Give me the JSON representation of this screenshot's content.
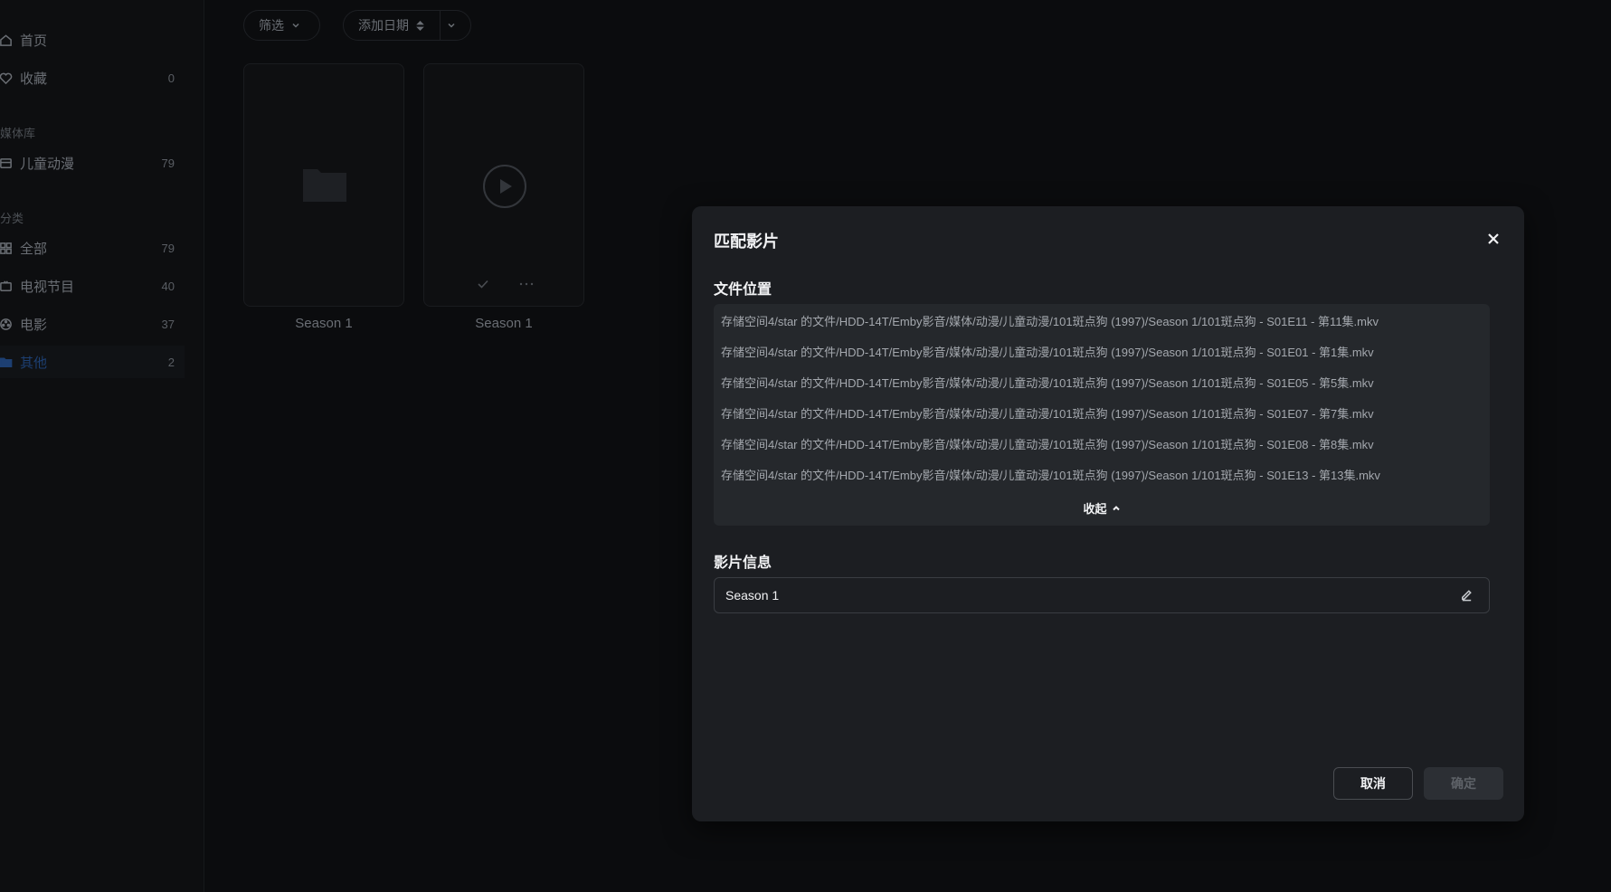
{
  "sidebar": {
    "nav": [
      {
        "label": "首页",
        "count": ""
      },
      {
        "label": "收藏",
        "count": "0"
      }
    ],
    "library_title": "媒体库",
    "libraries": [
      {
        "label": "儿童动漫",
        "count": "79"
      }
    ],
    "category_title": "分类",
    "categories": [
      {
        "label": "全部",
        "count": "79"
      },
      {
        "label": "电视节目",
        "count": "40"
      },
      {
        "label": "电影",
        "count": "37"
      },
      {
        "label": "其他",
        "count": "2"
      }
    ]
  },
  "toolbar": {
    "filter_label": "筛选",
    "sort_label": "添加日期"
  },
  "grid": {
    "items": [
      {
        "label": "Season 1",
        "icon": "folder-icon"
      },
      {
        "label": "Season 1",
        "icon": "play-icon"
      }
    ]
  },
  "dialog": {
    "title": "匹配影片",
    "file_location_title": "文件位置",
    "files": [
      "存储空间4/star 的文件/HDD-14T/Emby影音/媒体/动漫/儿童动漫/101斑点狗 (1997)/Season 1/101斑点狗 - S01E11 - 第11集.mkv",
      "存储空间4/star 的文件/HDD-14T/Emby影音/媒体/动漫/儿童动漫/101斑点狗 (1997)/Season 1/101斑点狗 - S01E01 - 第1集.mkv",
      "存储空间4/star 的文件/HDD-14T/Emby影音/媒体/动漫/儿童动漫/101斑点狗 (1997)/Season 1/101斑点狗 - S01E05 - 第5集.mkv",
      "存储空间4/star 的文件/HDD-14T/Emby影音/媒体/动漫/儿童动漫/101斑点狗 (1997)/Season 1/101斑点狗 - S01E07 - 第7集.mkv",
      "存储空间4/star 的文件/HDD-14T/Emby影音/媒体/动漫/儿童动漫/101斑点狗 (1997)/Season 1/101斑点狗 - S01E08 - 第8集.mkv",
      "存储空间4/star 的文件/HDD-14T/Emby影音/媒体/动漫/儿童动漫/101斑点狗 (1997)/Season 1/101斑点狗 - S01E13 - 第13集.mkv"
    ],
    "collapse_label": "收起",
    "info_title": "影片信息",
    "info_value": "Season 1",
    "cancel_label": "取消",
    "confirm_label": "确定"
  },
  "colors": {
    "accent": "#1d3f72",
    "dialog_bg": "#1c1e22",
    "files_bg": "#25282c"
  }
}
